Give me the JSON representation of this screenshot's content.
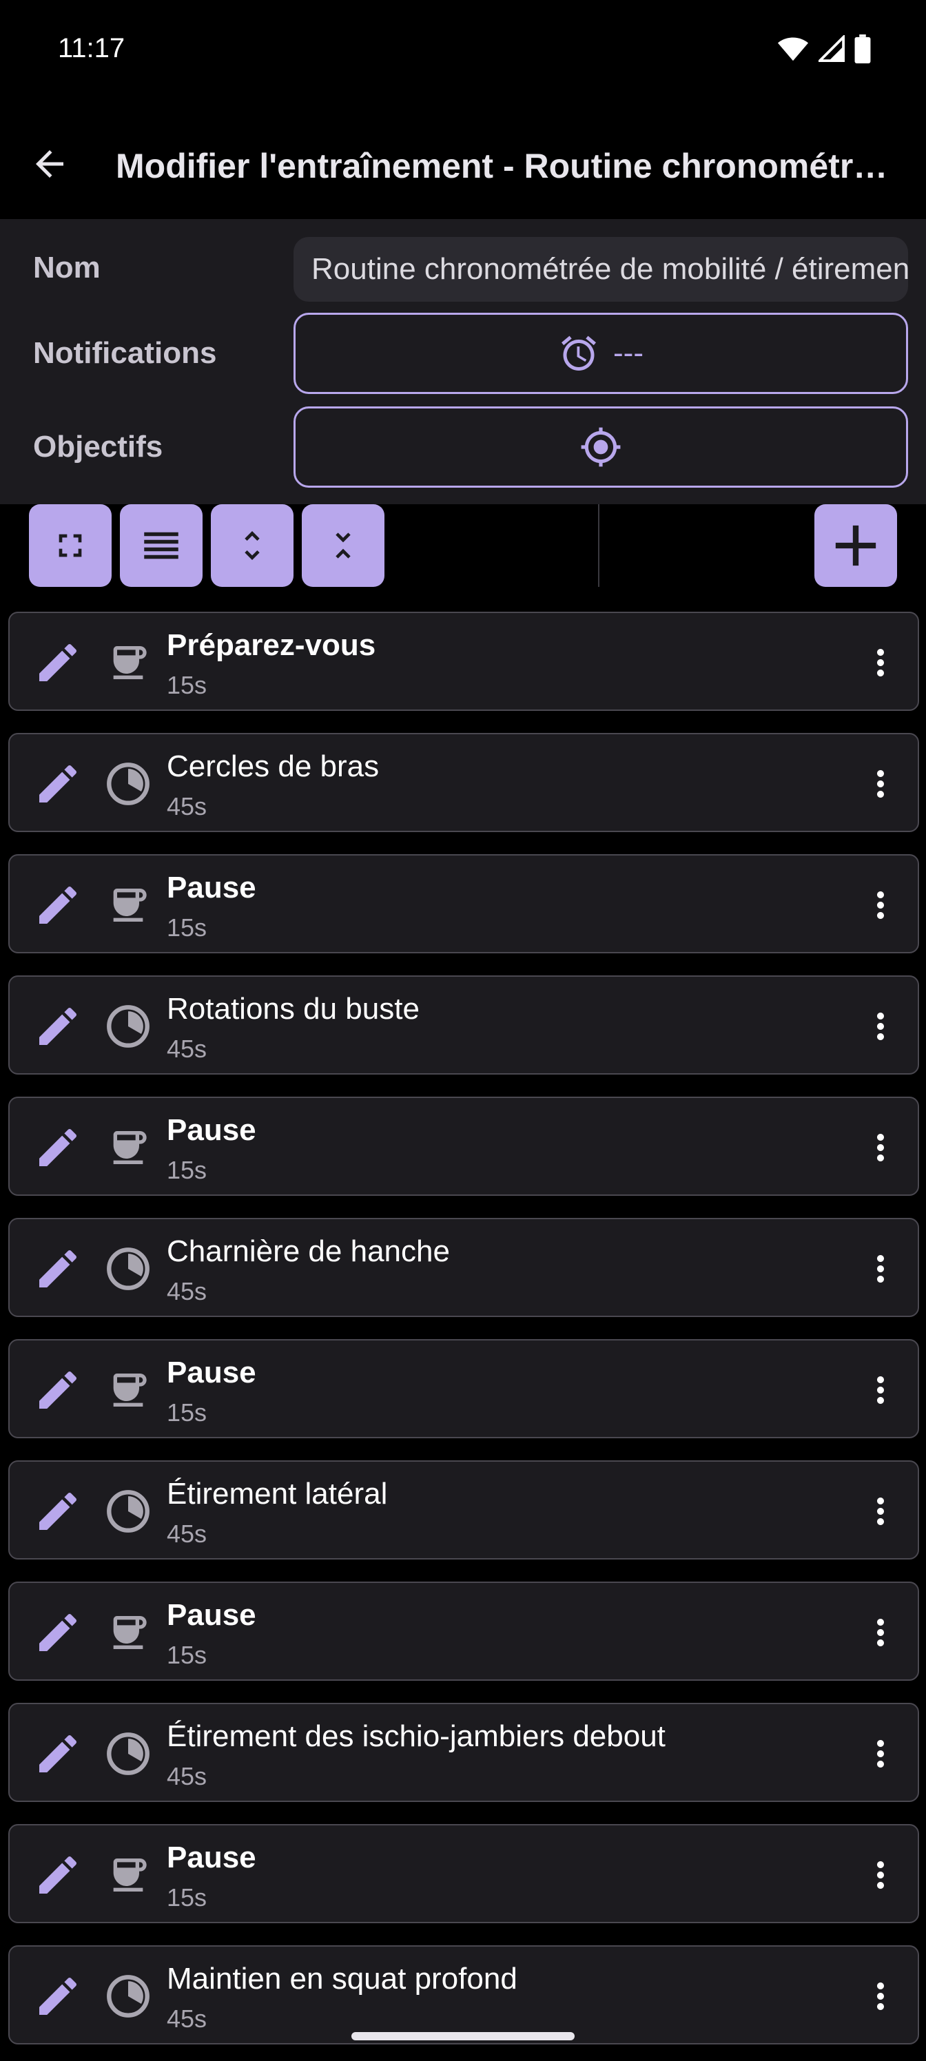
{
  "status_bar": {
    "time": "11:17"
  },
  "app_bar": {
    "title": "Modifier l'entraînement - Routine chronométrée de mobilité / étirements"
  },
  "form": {
    "name_label": "Nom",
    "name_value": "Routine chronométrée de mobilité / étirements",
    "notifications_label": "Notifications",
    "notifications_value": "---",
    "goals_label": "Objectifs"
  },
  "colors": {
    "accent": "#b8a7ec",
    "surface": "#1c1b1f",
    "background": "#000000"
  },
  "steps": [
    {
      "title": "Préparez-vous",
      "duration": "15s",
      "kind": "rest"
    },
    {
      "title": "Cercles de bras",
      "duration": "45s",
      "kind": "timed"
    },
    {
      "title": "Pause",
      "duration": "15s",
      "kind": "rest"
    },
    {
      "title": "Rotations du buste",
      "duration": "45s",
      "kind": "timed"
    },
    {
      "title": "Pause",
      "duration": "15s",
      "kind": "rest"
    },
    {
      "title": "Charnière de hanche",
      "duration": "45s",
      "kind": "timed"
    },
    {
      "title": "Pause",
      "duration": "15s",
      "kind": "rest"
    },
    {
      "title": "Étirement latéral",
      "duration": "45s",
      "kind": "timed"
    },
    {
      "title": "Pause",
      "duration": "15s",
      "kind": "rest"
    },
    {
      "title": "Étirement des ischio-jambiers debout",
      "duration": "45s",
      "kind": "timed"
    },
    {
      "title": "Pause",
      "duration": "15s",
      "kind": "rest"
    },
    {
      "title": "Maintien en squat profond",
      "duration": "45s",
      "kind": "timed"
    }
  ]
}
